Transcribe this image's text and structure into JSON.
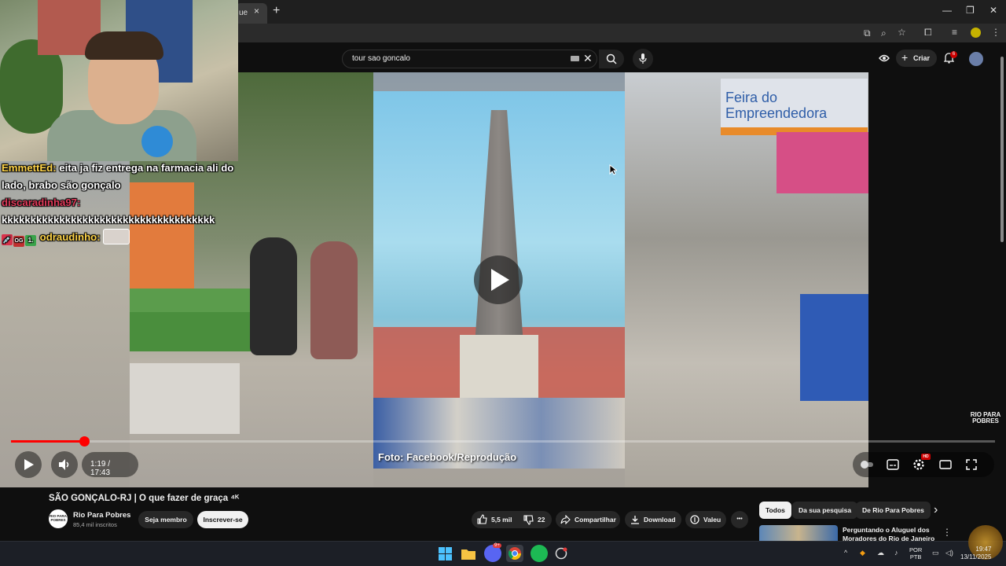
{
  "browser": {
    "tab_label": "ue",
    "tab_close": "×",
    "new_tab": "+",
    "minimize": "—",
    "restore": "❐",
    "close": "✕"
  },
  "header": {
    "search_value": "tour sao goncalo",
    "search_clear": "✕",
    "create_label": "Criar",
    "create_plus": "+",
    "notifications_count": "6"
  },
  "video": {
    "photo_caption": "Foto: Facebook/Reprodução",
    "sign_text": "Feira do Empreendedora",
    "watermark": "RIO PARA POBRES",
    "progress_fraction": 0.0745
  },
  "controls": {
    "time": "1:19 / 17:43",
    "hd_badge": "HD"
  },
  "overlay": {
    "chat": [
      {
        "user": "EmmettEd:",
        "message": "eita ja fiz entrega na farmacia ali do lado, brabo são gonçalo"
      },
      {
        "user": "discaradinha97:",
        "message": "kkkkkkkkkkkkkkkkkkkkkkkkkkkkkkkkkkkkk"
      },
      {
        "user": "odraudinho:",
        "message": "",
        "badges": [
          "💉",
          "OG",
          "1."
        ]
      }
    ]
  },
  "below": {
    "title": "SÃO GONÇALO-RJ | O que fazer de graça ⁴ᴷ",
    "channel_name": "Rio Para Pobres",
    "channel_avatar_text": "RIO PARA POBRES",
    "subscribers": "85,4 mil inscritos",
    "member_label": "Seja membro",
    "subscribe_label": "Inscrever-se",
    "likes": "5,5 mil",
    "dislikes": "22",
    "share_label": "Compartilhar",
    "download_label": "Download",
    "thanks_label": "Valeu",
    "more": "•••"
  },
  "chips": {
    "items": [
      "Todos",
      "Da sua pesquisa",
      "De Rio Para Pobres"
    ],
    "next": "›"
  },
  "recommendation": {
    "title": "Perguntando o Aluguel dos Moradores do Rio de Janeiro",
    "more": "⋮"
  },
  "taskbar": {
    "discord_badge": "9+",
    "lang": "POR",
    "layout": "PTB",
    "time": "19:47",
    "date": "13/11/2025",
    "chevron": "^"
  },
  "colors": {
    "accent_red": "#ff0000",
    "chat_user_yellow": "#ffd54a",
    "chat_user_red": "#e23b5b"
  }
}
